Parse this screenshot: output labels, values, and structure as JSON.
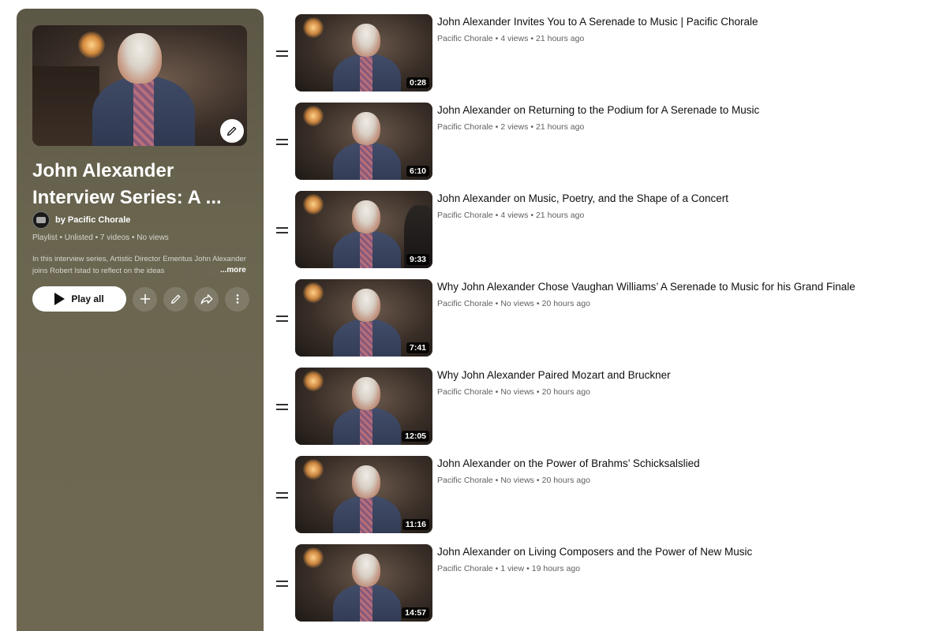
{
  "playlist": {
    "title": "John Alexander Interview Series: A ...",
    "channel": "by Pacific Chorale",
    "meta": "Playlist • Unlisted • 7 videos • No views",
    "description": "In this interview series, Artistic Director Emeritus John Alexander joins Robert Istad to reflect on the ideas",
    "more_label": "...more",
    "play_all_label": "Play all"
  },
  "icons": {
    "hero_edit": "pencil-icon",
    "play": "play-icon",
    "add": "plus-icon",
    "edit": "pencil-icon",
    "share": "share-icon",
    "more": "more-vert-icon",
    "drag": "drag-handle-icon"
  },
  "videos": [
    {
      "title": "John Alexander Invites You to A Serenade to Music | Pacific Chorale",
      "channel": "Pacific Chorale",
      "views": "4 views",
      "age": "21 hours ago",
      "duration": "0:28"
    },
    {
      "title": "John Alexander on Returning to the Podium for A Serenade to Music",
      "channel": "Pacific Chorale",
      "views": "2 views",
      "age": "21 hours ago",
      "duration": "6:10"
    },
    {
      "title": "John Alexander on Music, Poetry, and the Shape of a Concert",
      "channel": "Pacific Chorale",
      "views": "4 views",
      "age": "21 hours ago",
      "duration": "9:33"
    },
    {
      "title": "Why John Alexander Chose Vaughan Williams’ A Serenade to Music for his Grand Finale",
      "channel": "Pacific Chorale",
      "views": "No views",
      "age": "20 hours ago",
      "duration": "7:41"
    },
    {
      "title": "Why John Alexander Paired Mozart and Bruckner",
      "channel": "Pacific Chorale",
      "views": "No views",
      "age": "20 hours ago",
      "duration": "12:05"
    },
    {
      "title": "John Alexander on the Power of Brahms’ Schicksalslied",
      "channel": "Pacific Chorale",
      "views": "No views",
      "age": "20 hours ago",
      "duration": "11:16"
    },
    {
      "title": "John Alexander on Living Composers and the Power of New Music",
      "channel": "Pacific Chorale",
      "views": "1 view",
      "age": "19 hours ago",
      "duration": "14:57"
    }
  ]
}
